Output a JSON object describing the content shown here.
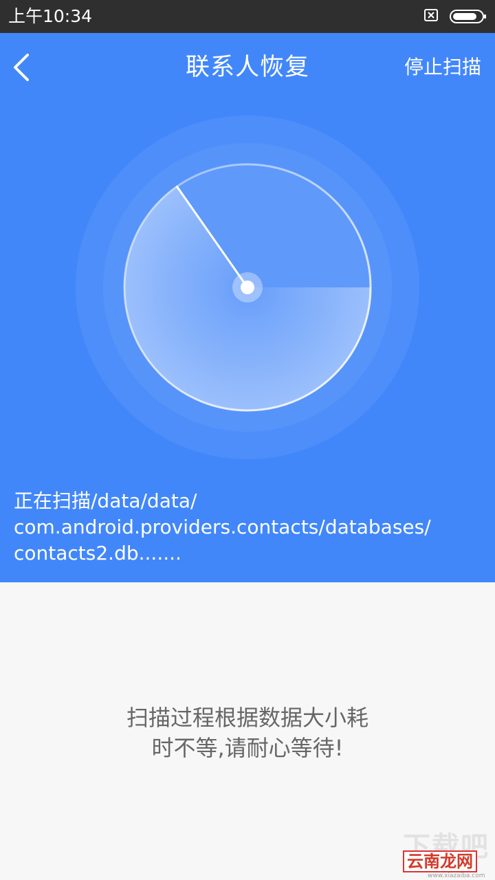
{
  "status_bar": {
    "time": "上午10:34",
    "icons": [
      "sim-card-icon",
      "battery-icon"
    ]
  },
  "header": {
    "back_icon": "chevron-left-icon",
    "title": "联系人恢复",
    "stop_scan_label": "停止扫描"
  },
  "scan": {
    "path_lines": [
      "正在扫描/data/data/",
      "com.android.providers.contacts/databases/",
      "contacts2.db......."
    ]
  },
  "tip": {
    "lines": [
      "扫描过程根据数据大小耗",
      "时不等,请耐心等待!"
    ]
  },
  "watermark": {
    "top": "下载吧",
    "badge": "云南龙网",
    "url": "www.xiazaiba.com"
  },
  "colors": {
    "header_bg": "#4287fa",
    "body_bg": "#f7f7f7",
    "status_bar_bg": "#2f2f2f",
    "tip_text": "#666666"
  }
}
